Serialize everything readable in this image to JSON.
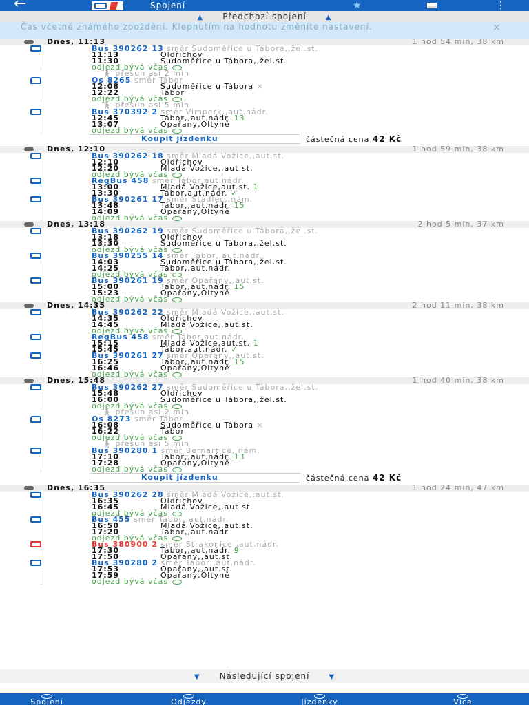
{
  "topbar": {
    "back_icon": "arrow-left-icon",
    "title": "Spojení",
    "star_icon": "star-icon",
    "menu_icon": "more-icon"
  },
  "prev_label": "Předchozí spojení",
  "notice": {
    "text": "Čas včetně známého zpoždění. Klepnutím na hodnotu změníte nastavení.",
    "close": "×"
  },
  "ontime_text": "odjezd bývá včas",
  "ticket": {
    "button": "Koupit jízdenku",
    "price_label": "částečná cena",
    "price": "42 Kč"
  },
  "connections": [
    {
      "title": "Dnes, 11:13",
      "meta": "1 hod 54 min, 38 km",
      "items": [
        {
          "type": "seg",
          "icon": "bus",
          "line": "Bus 390262 13",
          "dir": "směr Sudoměřice u Tábora,,žel.st.",
          "rows": [
            {
              "t": "11:13",
              "s": "Oldřichov",
              "p": ""
            },
            {
              "t": "11:30",
              "s": "Sudoměřice u Tábora,,žel.st.",
              "p": ""
            }
          ],
          "ontime": true
        },
        {
          "type": "transfer",
          "text": "přesun asi 2 min"
        },
        {
          "type": "seg",
          "icon": "train",
          "line": "Os 8265",
          "dir": "směr Tábor",
          "rows": [
            {
              "t": "12:08",
              "s": "Sudoměřice u Tábora",
              "p": "",
              "x": "×"
            },
            {
              "t": "12:22",
              "s": "Tábor",
              "p": ""
            }
          ],
          "ontime": true
        },
        {
          "type": "transfer",
          "text": "přesun asi 5 min"
        },
        {
          "type": "seg",
          "icon": "bus",
          "line": "Bus 370392 2",
          "dir": "směr Vimperk,,aut.nádr.",
          "rows": [
            {
              "t": "12:45",
              "s": "Tábor,,aut.nádr.",
              "p": "13"
            },
            {
              "t": "13:07",
              "s": "Opařany,Oltyně",
              "p": ""
            }
          ],
          "ontime": true
        },
        {
          "type": "ticket"
        }
      ]
    },
    {
      "title": "Dnes, 12:10",
      "meta": "1 hod 59 min, 38 km",
      "items": [
        {
          "type": "seg",
          "icon": "bus",
          "line": "Bus 390262 18",
          "dir": "směr Mladá Vožice,,aut.st.",
          "rows": [
            {
              "t": "12:10",
              "s": "Oldřichov",
              "p": ""
            },
            {
              "t": "12:20",
              "s": "Mladá Vožice,,aut.st.",
              "p": ""
            }
          ],
          "ontime": true
        },
        {
          "type": "seg",
          "icon": "bus",
          "line": "RegBus 458",
          "dir": "směr Tábor,aut.nádr.",
          "rows": [
            {
              "t": "13:00",
              "s": "Mladá Vožice,aut.st.",
              "p": "1"
            },
            {
              "t": "13:30",
              "s": "Tábor,aut.nádr.",
              "p": "✓"
            }
          ],
          "ontime": false
        },
        {
          "type": "seg",
          "icon": "bus",
          "line": "Bus 390261 17",
          "dir": "směr Stádlec,,nám.",
          "rows": [
            {
              "t": "13:48",
              "s": "Tábor,,aut.nádr.",
              "p": "15"
            },
            {
              "t": "14:09",
              "s": "Opařany,Oltyně",
              "p": ""
            }
          ],
          "ontime": true
        }
      ]
    },
    {
      "title": "Dnes, 13:18",
      "meta": "2 hod 5 min, 37 km",
      "items": [
        {
          "type": "seg",
          "icon": "bus",
          "line": "Bus 390262 19",
          "dir": "směr Sudoměřice u Tábora,,žel.st.",
          "rows": [
            {
              "t": "13:18",
              "s": "Oldřichov",
              "p": ""
            },
            {
              "t": "13:30",
              "s": "Sudoměřice u Tábora,,žel.st.",
              "p": ""
            }
          ],
          "ontime": true
        },
        {
          "type": "seg",
          "icon": "bus",
          "line": "Bus 390255 14",
          "dir": "směr Tábor,,aut.nádr.",
          "rows": [
            {
              "t": "14:03",
              "s": "Sudoměřice u Tábora,,žel.st.",
              "p": ""
            },
            {
              "t": "14:25",
              "s": "Tábor,,aut.nádr.",
              "p": ""
            }
          ],
          "ontime": true
        },
        {
          "type": "seg",
          "icon": "bus",
          "line": "Bus 390261 19",
          "dir": "směr Opařany,,aut.st.",
          "rows": [
            {
              "t": "15:00",
              "s": "Tábor,,aut.nádr.",
              "p": "15"
            },
            {
              "t": "15:23",
              "s": "Opařany,Oltyně",
              "p": ""
            }
          ],
          "ontime": true
        }
      ]
    },
    {
      "title": "Dnes, 14:35",
      "meta": "2 hod 11 min, 38 km",
      "items": [
        {
          "type": "seg",
          "icon": "bus",
          "line": "Bus 390262 22",
          "dir": "směr Mladá Vožice,,aut.st.",
          "rows": [
            {
              "t": "14:35",
              "s": "Oldřichov",
              "p": ""
            },
            {
              "t": "14:45",
              "s": "Mladá Vožice,,aut.st.",
              "p": ""
            }
          ],
          "ontime": true
        },
        {
          "type": "seg",
          "icon": "bus",
          "line": "RegBus 458",
          "dir": "směr Tábor,aut.nádr.",
          "rows": [
            {
              "t": "15:15",
              "s": "Mladá Vožice,aut.st.",
              "p": "1"
            },
            {
              "t": "15:45",
              "s": "Tábor,aut.nádr.",
              "p": "✓"
            }
          ],
          "ontime": false
        },
        {
          "type": "seg",
          "icon": "bus",
          "line": "Bus 390261 27",
          "dir": "směr Opařany,,aut.st.",
          "rows": [
            {
              "t": "16:25",
              "s": "Tábor,,aut.nádr.",
              "p": "15"
            },
            {
              "t": "16:46",
              "s": "Opařany,Oltyně",
              "p": ""
            }
          ],
          "ontime": true
        }
      ]
    },
    {
      "title": "Dnes, 15:48",
      "meta": "1 hod 40 min, 38 km",
      "items": [
        {
          "type": "seg",
          "icon": "bus",
          "line": "Bus 390262 27",
          "dir": "směr Sudoměřice u Tábora,,žel.st.",
          "rows": [
            {
              "t": "15:48",
              "s": "Oldřichov",
              "p": ""
            },
            {
              "t": "16:00",
              "s": "Sudoměřice u Tábora,,žel.st.",
              "p": ""
            }
          ],
          "ontime": true
        },
        {
          "type": "transfer",
          "text": "přesun asi 2 min"
        },
        {
          "type": "seg",
          "icon": "train",
          "line": "Os 8273",
          "dir": "směr Tábor",
          "rows": [
            {
              "t": "16:08",
              "s": "Sudoměřice u Tábora",
              "p": "",
              "x": "×"
            },
            {
              "t": "16:22",
              "s": "Tábor",
              "p": ""
            }
          ],
          "ontime": true
        },
        {
          "type": "transfer",
          "text": "přesun asi 5 min"
        },
        {
          "type": "seg",
          "icon": "bus",
          "line": "Bus 390280 1",
          "dir": "směr Bernartice,,nám.",
          "rows": [
            {
              "t": "17:10",
              "s": "Tábor,,aut.nádr.",
              "p": "13"
            },
            {
              "t": "17:28",
              "s": "Opařany,Oltyně",
              "p": ""
            }
          ],
          "ontime": true
        },
        {
          "type": "ticket"
        }
      ]
    },
    {
      "title": "Dnes, 16:35",
      "meta": "1 hod 24 min, 47 km",
      "items": [
        {
          "type": "seg",
          "icon": "bus",
          "line": "Bus 390262 28",
          "dir": "směr Mladá Vožice,,aut.st.",
          "rows": [
            {
              "t": "16:35",
              "s": "Oldřichov",
              "p": ""
            },
            {
              "t": "16:45",
              "s": "Mladá Vožice,,aut.st.",
              "p": ""
            }
          ],
          "ontime": true
        },
        {
          "type": "seg",
          "icon": "bus",
          "line": "Bus 455",
          "dir": "směr Tábor,,aut.nádr.",
          "rows": [
            {
              "t": "16:50",
              "s": "Mladá Vožice,,aut.st.",
              "p": ""
            },
            {
              "t": "17:20",
              "s": "Tábor,,aut.nádr.",
              "p": ""
            }
          ],
          "ontime": true
        },
        {
          "type": "seg",
          "icon": "bus-red",
          "line": "Bus 380900 2",
          "dir": "směr Strakonice,,aut.nádr.",
          "rows": [
            {
              "t": "17:30",
              "s": "Tábor,,aut.nádr.",
              "p": "9"
            },
            {
              "t": "17:50",
              "s": "Opařany,,aut.st.",
              "p": ""
            }
          ],
          "ontime": false
        },
        {
          "type": "seg",
          "icon": "bus",
          "line": "Bus 390280 2",
          "dir": "směr Tábor,,aut.nádr.",
          "rows": [
            {
              "t": "17:53",
              "s": "Opařany,,aut.st.",
              "p": ""
            },
            {
              "t": "17:59",
              "s": "Opařany,Oltyně",
              "p": ""
            }
          ],
          "ontime": true
        }
      ]
    }
  ],
  "next_label": "Následující spojení",
  "bottom_nav": [
    {
      "label": "Spojení",
      "icon": "search-icon"
    },
    {
      "label": "Odjezdy",
      "icon": "clock-icon"
    },
    {
      "label": "Jízdenky",
      "icon": "ticket-icon"
    },
    {
      "label": "Více",
      "icon": "menu-icon"
    }
  ],
  "colors": {
    "primary": "#1565c0",
    "green": "#43a047",
    "red": "#e53935"
  }
}
